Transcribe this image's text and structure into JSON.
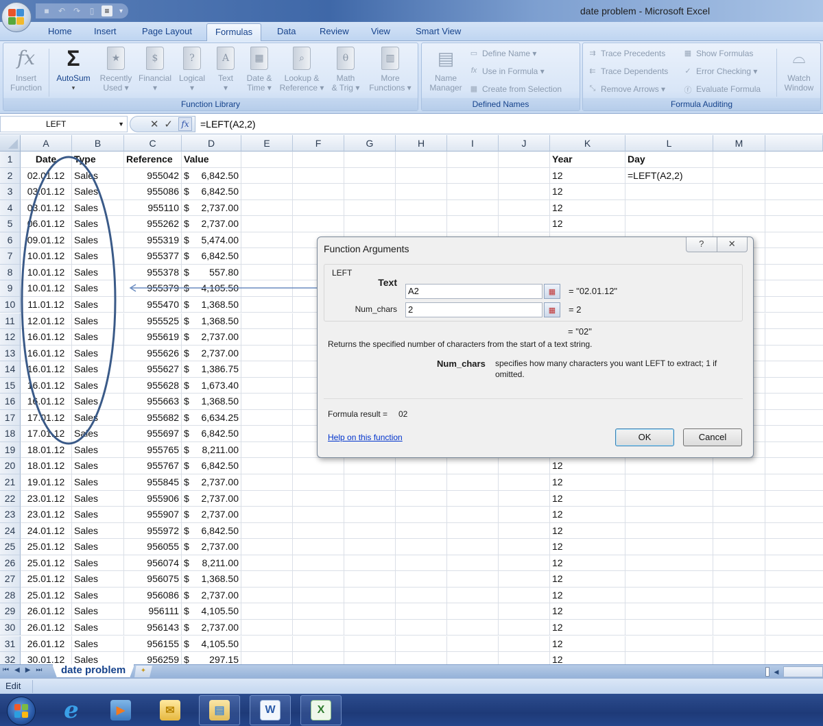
{
  "window": {
    "title": "date problem - Microsoft Excel"
  },
  "quick_access": {
    "icons": [
      "save-icon",
      "undo-icon",
      "redo-icon",
      "print-preview-icon",
      "align-icon"
    ]
  },
  "ribbon_tabs": [
    {
      "label": "Home",
      "active": false
    },
    {
      "label": "Insert",
      "active": false
    },
    {
      "label": "Page Layout",
      "active": false
    },
    {
      "label": "Formulas",
      "active": true
    },
    {
      "label": "Data",
      "active": false
    },
    {
      "label": "Review",
      "active": false
    },
    {
      "label": "View",
      "active": false
    },
    {
      "label": "Smart View",
      "active": false
    }
  ],
  "ribbon": {
    "function_library": {
      "label": "Function Library",
      "insert_function": {
        "line1": "Insert",
        "line2": "Function"
      },
      "autosum": {
        "line1": "AutoSum",
        "line2": "▾"
      },
      "recently_used": {
        "line1": "Recently",
        "line2": "Used ▾",
        "glyph": "★"
      },
      "financial": {
        "line1": "Financial",
        "line2": "▾",
        "glyph": "$"
      },
      "logical": {
        "line1": "Logical",
        "line2": "▾",
        "glyph": "?"
      },
      "text": {
        "line1": "Text",
        "line2": "▾",
        "glyph": "A"
      },
      "date_time": {
        "line1": "Date &",
        "line2": "Time ▾",
        "glyph": "▦"
      },
      "lookup_reference": {
        "line1": "Lookup &",
        "line2": "Reference ▾",
        "glyph": "⌕"
      },
      "math_trig": {
        "line1": "Math",
        "line2": "& Trig ▾",
        "glyph": "θ"
      },
      "more_functions": {
        "line1": "More",
        "line2": "Functions ▾",
        "glyph": "▥"
      }
    },
    "defined_names": {
      "label": "Defined Names",
      "name_manager": {
        "line1": "Name",
        "line2": "Manager"
      },
      "define_name": "Define Name ▾",
      "use_in_formula": "Use in Formula ▾",
      "create_from_selection": "Create from Selection"
    },
    "formula_auditing": {
      "label": "Formula Auditing",
      "trace_precedents": "Trace Precedents",
      "trace_dependents": "Trace Dependents",
      "remove_arrows": "Remove Arrows ▾",
      "show_formulas": "Show Formulas",
      "error_checking": "Error Checking ▾",
      "evaluate_formula": "Evaluate Formula",
      "watch_window": {
        "line1": "Watch",
        "line2": "Window"
      }
    }
  },
  "formula_bar": {
    "name_box": "LEFT",
    "cancel_glyph": "✕",
    "enter_glyph": "✓",
    "fx_glyph": "fx",
    "formula": "=LEFT(A2,2)"
  },
  "columns": [
    "A",
    "B",
    "C",
    "D",
    "E",
    "F",
    "G",
    "H",
    "I",
    "J",
    "K",
    "L",
    "M"
  ],
  "rows": [
    {
      "n": "1",
      "A": "Date",
      "B": "Type",
      "C": "Reference",
      "D_sym": "Value",
      "D_amt": "",
      "K": "Year",
      "L": "Day"
    },
    {
      "n": "2",
      "A": "02.01.12",
      "B": "Sales",
      "C": "955042",
      "D_sym": "$",
      "D_amt": "6,842.50",
      "K": "12",
      "L": "=LEFT(A2,2)"
    },
    {
      "n": "3",
      "A": "03.01.12",
      "B": "Sales",
      "C": "955086",
      "D_sym": "$",
      "D_amt": "6,842.50",
      "K": "12",
      "L": ""
    },
    {
      "n": "4",
      "A": "03.01.12",
      "B": "Sales",
      "C": "955110",
      "D_sym": "$",
      "D_amt": "2,737.00",
      "K": "12",
      "L": ""
    },
    {
      "n": "5",
      "A": "06.01.12",
      "B": "Sales",
      "C": "955262",
      "D_sym": "$",
      "D_amt": "2,737.00",
      "K": "12",
      "L": ""
    },
    {
      "n": "6",
      "A": "09.01.12",
      "B": "Sales",
      "C": "955319",
      "D_sym": "$",
      "D_amt": "5,474.00",
      "K": "",
      "L": ""
    },
    {
      "n": "7",
      "A": "10.01.12",
      "B": "Sales",
      "C": "955377",
      "D_sym": "$",
      "D_amt": "6,842.50",
      "K": "",
      "L": ""
    },
    {
      "n": "8",
      "A": "10.01.12",
      "B": "Sales",
      "C": "955378",
      "D_sym": "$",
      "D_amt": "557.80",
      "K": "",
      "L": ""
    },
    {
      "n": "9",
      "A": "10.01.12",
      "B": "Sales",
      "C": "955379",
      "D_sym": "$",
      "D_amt": "4,105.50",
      "K": "",
      "L": ""
    },
    {
      "n": "10",
      "A": "11.01.12",
      "B": "Sales",
      "C": "955470",
      "D_sym": "$",
      "D_amt": "1,368.50",
      "K": "",
      "L": ""
    },
    {
      "n": "11",
      "A": "12.01.12",
      "B": "Sales",
      "C": "955525",
      "D_sym": "$",
      "D_amt": "1,368.50",
      "K": "",
      "L": ""
    },
    {
      "n": "12",
      "A": "16.01.12",
      "B": "Sales",
      "C": "955619",
      "D_sym": "$",
      "D_amt": "2,737.00",
      "K": "",
      "L": ""
    },
    {
      "n": "13",
      "A": "16.01.12",
      "B": "Sales",
      "C": "955626",
      "D_sym": "$",
      "D_amt": "2,737.00",
      "K": "",
      "L": ""
    },
    {
      "n": "14",
      "A": "16.01.12",
      "B": "Sales",
      "C": "955627",
      "D_sym": "$",
      "D_amt": "1,386.75",
      "K": "",
      "L": ""
    },
    {
      "n": "15",
      "A": "16.01.12",
      "B": "Sales",
      "C": "955628",
      "D_sym": "$",
      "D_amt": "1,673.40",
      "K": "",
      "L": ""
    },
    {
      "n": "16",
      "A": "16.01.12",
      "B": "Sales",
      "C": "955663",
      "D_sym": "$",
      "D_amt": "1,368.50",
      "K": "",
      "L": ""
    },
    {
      "n": "17",
      "A": "17.01.12",
      "B": "Sales",
      "C": "955682",
      "D_sym": "$",
      "D_amt": "6,634.25",
      "K": "",
      "L": ""
    },
    {
      "n": "18",
      "A": "17.01.12",
      "B": "Sales",
      "C": "955697",
      "D_sym": "$",
      "D_amt": "6,842.50",
      "K": "",
      "L": ""
    },
    {
      "n": "19",
      "A": "18.01.12",
      "B": "Sales",
      "C": "955765",
      "D_sym": "$",
      "D_amt": "8,211.00",
      "K": "",
      "L": ""
    },
    {
      "n": "20",
      "A": "18.01.12",
      "B": "Sales",
      "C": "955767",
      "D_sym": "$",
      "D_amt": "6,842.50",
      "K": "12",
      "L": ""
    },
    {
      "n": "21",
      "A": "19.01.12",
      "B": "Sales",
      "C": "955845",
      "D_sym": "$",
      "D_amt": "2,737.00",
      "K": "12",
      "L": ""
    },
    {
      "n": "22",
      "A": "23.01.12",
      "B": "Sales",
      "C": "955906",
      "D_sym": "$",
      "D_amt": "2,737.00",
      "K": "12",
      "L": ""
    },
    {
      "n": "23",
      "A": "23.01.12",
      "B": "Sales",
      "C": "955907",
      "D_sym": "$",
      "D_amt": "2,737.00",
      "K": "12",
      "L": ""
    },
    {
      "n": "24",
      "A": "24.01.12",
      "B": "Sales",
      "C": "955972",
      "D_sym": "$",
      "D_amt": "6,842.50",
      "K": "12",
      "L": ""
    },
    {
      "n": "25",
      "A": "25.01.12",
      "B": "Sales",
      "C": "956055",
      "D_sym": "$",
      "D_amt": "2,737.00",
      "K": "12",
      "L": ""
    },
    {
      "n": "26",
      "A": "25.01.12",
      "B": "Sales",
      "C": "956074",
      "D_sym": "$",
      "D_amt": "8,211.00",
      "K": "12",
      "L": ""
    },
    {
      "n": "27",
      "A": "25.01.12",
      "B": "Sales",
      "C": "956075",
      "D_sym": "$",
      "D_amt": "1,368.50",
      "K": "12",
      "L": ""
    },
    {
      "n": "28",
      "A": "25.01.12",
      "B": "Sales",
      "C": "956086",
      "D_sym": "$",
      "D_amt": "2,737.00",
      "K": "12",
      "L": ""
    },
    {
      "n": "29",
      "A": "26.01.12",
      "B": "Sales",
      "C": "956111",
      "D_sym": "$",
      "D_amt": "4,105.50",
      "K": "12",
      "L": ""
    },
    {
      "n": "30",
      "A": "26.01.12",
      "B": "Sales",
      "C": "956143",
      "D_sym": "$",
      "D_amt": "2,737.00",
      "K": "12",
      "L": ""
    },
    {
      "n": "31",
      "A": "26.01.12",
      "B": "Sales",
      "C": "956155",
      "D_sym": "$",
      "D_amt": "4,105.50",
      "K": "12",
      "L": ""
    },
    {
      "n": "32",
      "A": "30.01.12",
      "B": "Sales",
      "C": "956259",
      "D_sym": "$",
      "D_amt": "297.15",
      "K": "12",
      "L": ""
    }
  ],
  "dialog": {
    "title": "Function Arguments",
    "help_glyph": "?",
    "close_glyph": "✕",
    "function_name": "LEFT",
    "args": [
      {
        "label": "Text",
        "value": "A2",
        "result": "=  \"02.01.12\""
      },
      {
        "label": "Num_chars",
        "value": "2",
        "result": "=  2"
      }
    ],
    "overall_result": "=  \"02\"",
    "description": "Returns the specified number of characters from the start of a text string.",
    "arg_help_name": "Num_chars",
    "arg_help_text_line1": "specifies how many characters you want LEFT to extract; 1 if",
    "arg_help_text_line2": "omitted.",
    "formula_result_label": "Formula result =",
    "formula_result_value": "02",
    "help_link": "Help on this function",
    "ok_label": "OK",
    "cancel_label": "Cancel"
  },
  "sheet_tabs": {
    "nav": [
      "⏮",
      "◀",
      "▶",
      "⏭"
    ],
    "tabs": [
      "date problem"
    ],
    "active": "date problem"
  },
  "status_bar": {
    "mode": "Edit"
  },
  "taskbar": {
    "items": [
      "start-button",
      "internet-explorer",
      "media-player",
      "outlook",
      "windows-explorer",
      "word",
      "excel"
    ],
    "word_glyph": "W",
    "excel_glyph": "X",
    "ie_glyph": "e"
  }
}
